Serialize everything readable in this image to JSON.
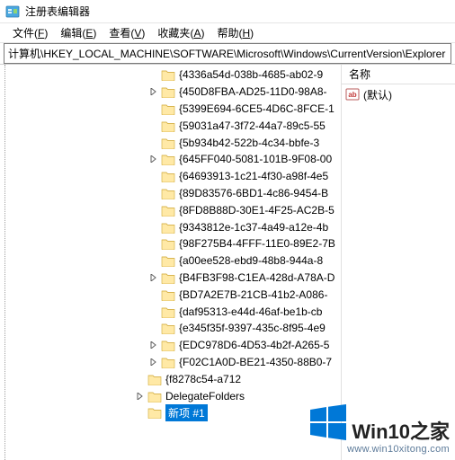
{
  "window": {
    "title": "注册表编辑器"
  },
  "menu": {
    "items": [
      {
        "label": "文件",
        "accel": "F"
      },
      {
        "label": "编辑",
        "accel": "E"
      },
      {
        "label": "查看",
        "accel": "V"
      },
      {
        "label": "收藏夹",
        "accel": "A"
      },
      {
        "label": "帮助",
        "accel": "H"
      }
    ]
  },
  "address": {
    "path": "计算机\\HKEY_LOCAL_MACHINE\\SOFTWARE\\Microsoft\\Windows\\CurrentVersion\\Explorer"
  },
  "tree": {
    "visible_items": [
      {
        "label": "{4336a54d-038b-4685-ab02-9",
        "expandable": false
      },
      {
        "label": "{450D8FBA-AD25-11D0-98A8-",
        "expandable": true
      },
      {
        "label": "{5399E694-6CE5-4D6C-8FCE-1",
        "expandable": false
      },
      {
        "label": "{59031a47-3f72-44a7-89c5-55",
        "expandable": false
      },
      {
        "label": "{5b934b42-522b-4c34-bbfe-3",
        "expandable": false
      },
      {
        "label": "{645FF040-5081-101B-9F08-00",
        "expandable": true
      },
      {
        "label": "{64693913-1c21-4f30-a98f-4e5",
        "expandable": false
      },
      {
        "label": "{89D83576-6BD1-4c86-9454-B",
        "expandable": false
      },
      {
        "label": "{8FD8B88D-30E1-4F25-AC2B-5",
        "expandable": false
      },
      {
        "label": "{9343812e-1c37-4a49-a12e-4b",
        "expandable": false
      },
      {
        "label": "{98F275B4-4FFF-11E0-89E2-7B",
        "expandable": false
      },
      {
        "label": "{a00ee528-ebd9-48b8-944a-8",
        "expandable": false
      },
      {
        "label": "{B4FB3F98-C1EA-428d-A78A-D",
        "expandable": true
      },
      {
        "label": "{BD7A2E7B-21CB-41b2-A086-",
        "expandable": false
      },
      {
        "label": "{daf95313-e44d-46af-be1b-cb",
        "expandable": false
      },
      {
        "label": "{e345f35f-9397-435c-8f95-4e9",
        "expandable": false
      },
      {
        "label": "{EDC978D6-4D53-4b2f-A265-5",
        "expandable": true
      },
      {
        "label": "{F02C1A0D-BE21-4350-88B0-7",
        "expandable": true
      },
      {
        "label": "{f8278c54-a712",
        "expandable": false,
        "level": 5
      },
      {
        "label": "DelegateFolders",
        "expandable": true,
        "level": 5
      },
      {
        "label": "新项 #1",
        "expandable": false,
        "level": 5,
        "editing": true
      }
    ]
  },
  "list": {
    "column_name": "名称",
    "rows": [
      {
        "name": "(默认)",
        "icon": "ab"
      }
    ]
  },
  "watermark": {
    "brand_main": "Win10",
    "brand_suffix": "之家",
    "url": "www.win10xitong.com"
  },
  "colors": {
    "accent": "#0078d7",
    "folder_light": "#ffe9a6",
    "folder_dark": "#e7c55b"
  }
}
